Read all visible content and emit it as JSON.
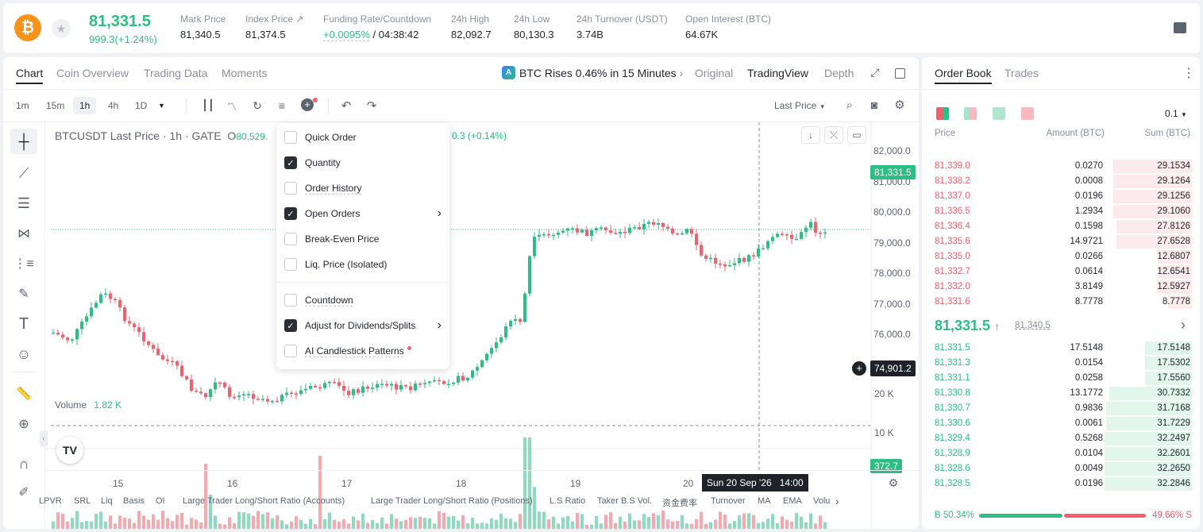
{
  "header": {
    "price": "81,331.5",
    "change": "999.3(+1.24%)",
    "stats": [
      {
        "label": "Mark Price",
        "value": "81,340.5"
      },
      {
        "label": "Index Price ↗",
        "value": "81,374.5"
      },
      {
        "label": "Funding Rate/Countdown",
        "value": "+0.0095%",
        "value2": "/ 04:38:42"
      },
      {
        "label": "24h High",
        "value": "82,092.7"
      },
      {
        "label": "24h Low",
        "value": "80,130.3"
      },
      {
        "label": "24h Turnover (USDT)",
        "value": "3.74B"
      },
      {
        "label": "Open Interest (BTC)",
        "value": "64.67K"
      }
    ]
  },
  "chart_tabs": [
    "Chart",
    "Coin Overview",
    "Trading Data",
    "Moments"
  ],
  "alert": "BTC Rises 0.46% in 15 Minutes",
  "view_tabs": [
    "Original",
    "TradingView",
    "Depth"
  ],
  "timeframes": [
    "1m",
    "15m",
    "1h",
    "4h",
    "1D"
  ],
  "price_type": "Last Price",
  "legend": {
    "symbol": "BTCUSDT Last Price · 1h · GATE",
    "o_label": "O",
    "o_value": "80,529.",
    "change": "0.3 (+0.14%)"
  },
  "menu": [
    {
      "label": "Quick Order",
      "checked": false
    },
    {
      "label": "Quantity",
      "checked": true
    },
    {
      "label": "Order History",
      "checked": false
    },
    {
      "label": "Open Orders",
      "checked": true,
      "arrow": true
    },
    {
      "label": "Break-Even Price",
      "checked": false
    },
    {
      "label": "Liq. Price (Isolated)",
      "checked": false
    },
    {
      "label": "Countdown",
      "checked": false
    },
    {
      "label": "Adjust for Dividends/Splits",
      "checked": true,
      "arrow": true
    },
    {
      "label": "AI Candlestick Patterns",
      "checked": false,
      "dot": true
    }
  ],
  "price_axis": [
    "82,000.0",
    "81,000.0",
    "80,000.0",
    "79,000.0",
    "78,000.0",
    "77,000.0",
    "76,000.0"
  ],
  "last_price_tag": "81,331.5",
  "crosshair_price": "74,901.2",
  "volume": {
    "label": "Volume",
    "value": "1.82 K",
    "axis": [
      "20 K",
      "10 K"
    ],
    "last_tag": "372.7"
  },
  "date_axis": [
    "15",
    "16",
    "17",
    "18",
    "19",
    "20"
  ],
  "crosshair_date": "Sun 20 Sep '26   14:00",
  "bottom_indicators": [
    "LPVR",
    "SRL",
    "Liq",
    "Basis",
    "OI",
    "Large Trader Long/Short Ratio (Accounts)",
    "Large Trader Long/Short Ratio (Positions)",
    "L.S Ratio",
    "Taker B.S Vol.",
    "资金费率",
    "Turnover",
    "MA",
    "EMA",
    "Volu"
  ],
  "order_book": {
    "tabs": [
      "Order Book",
      "Trades"
    ],
    "precision": "0.1",
    "columns": [
      "Price",
      "Amount (BTC)",
      "Sum (BTC)"
    ],
    "asks": [
      {
        "price": "81,339.0",
        "amount": "0.0270",
        "sum": "29.1534",
        "depth": 0.9
      },
      {
        "price": "81,338.2",
        "amount": "0.0008",
        "sum": "29.1264",
        "depth": 0.9
      },
      {
        "price": "81,337.0",
        "amount": "0.0196",
        "sum": "29.1256",
        "depth": 0.9
      },
      {
        "price": "81,336.5",
        "amount": "1.2934",
        "sum": "29.1060",
        "depth": 0.9
      },
      {
        "price": "81,336.4",
        "amount": "0.1598",
        "sum": "27.8126",
        "depth": 0.86
      },
      {
        "price": "81,335.6",
        "amount": "14.9721",
        "sum": "27.6528",
        "depth": 0.86
      },
      {
        "price": "81,335.0",
        "amount": "0.0266",
        "sum": "12.6807",
        "depth": 0.39
      },
      {
        "price": "81,332.7",
        "amount": "0.0614",
        "sum": "12.6541",
        "depth": 0.39
      },
      {
        "price": "81,332.0",
        "amount": "3.8149",
        "sum": "12.5927",
        "depth": 0.39
      },
      {
        "price": "81,331.6",
        "amount": "8.7778",
        "sum": "8.7778",
        "depth": 0.27
      }
    ],
    "mid_price": "81,331.5",
    "mid_mark": "81,340.5",
    "bids": [
      {
        "price": "81,331.5",
        "amount": "17.5148",
        "sum": "17.5148",
        "depth": 0.54
      },
      {
        "price": "81,331.3",
        "amount": "0.0154",
        "sum": "17.5302",
        "depth": 0.54
      },
      {
        "price": "81,331.1",
        "amount": "0.0258",
        "sum": "17.5560",
        "depth": 0.54
      },
      {
        "price": "81,330.8",
        "amount": "13.1772",
        "sum": "30.7332",
        "depth": 0.95
      },
      {
        "price": "81,330.7",
        "amount": "0.9836",
        "sum": "31.7168",
        "depth": 0.98
      },
      {
        "price": "81,330.6",
        "amount": "0.0061",
        "sum": "31.7229",
        "depth": 0.98
      },
      {
        "price": "81,329.4",
        "amount": "0.5268",
        "sum": "32.2497",
        "depth": 1.0
      },
      {
        "price": "81,328.9",
        "amount": "0.0104",
        "sum": "32.2601",
        "depth": 1.0
      },
      {
        "price": "81,328.6",
        "amount": "0.0049",
        "sum": "32.2650",
        "depth": 1.0
      },
      {
        "price": "81,328.5",
        "amount": "0.0196",
        "sum": "32.2846",
        "depth": 1.0
      }
    ],
    "buy_ratio": "B 50.34%",
    "sell_ratio": "49.66% S",
    "buy_fraction": 0.5034
  },
  "colors": {
    "up": "#2ebd85",
    "down": "#f0616d",
    "brand": "#f7931a"
  }
}
